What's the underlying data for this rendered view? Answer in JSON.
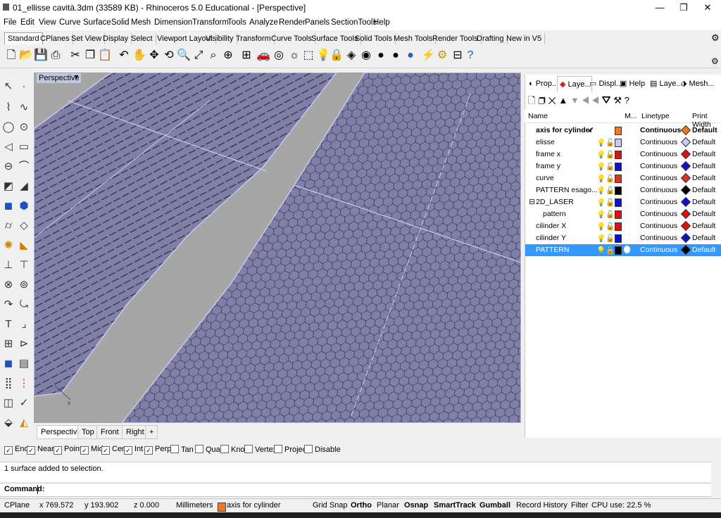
{
  "window": {
    "title": "01_ellisse cavità.3dm (33589 KB) - Rhinoceros 5.0 Educational - [Perspective]",
    "minimize_icon": "minimize-icon",
    "maximize_icon": "restore-icon",
    "close_icon": "close-icon"
  },
  "menu": [
    "File",
    "Edit",
    "View",
    "Curve",
    "Surface",
    "Solid",
    "Mesh",
    "Dimension",
    "Transform",
    "Tools",
    "Analyze",
    "Render",
    "Panels",
    "SectionTools",
    "Help"
  ],
  "toolbar_tabs": [
    "Standard",
    "CPlanes",
    "Set View",
    "Display",
    "Select",
    "Viewport Layout",
    "Visibility",
    "Transform",
    "Curve Tools",
    "Surface Tools",
    "Solid Tools",
    "Mesh Tools",
    "Render Tools",
    "Drafting",
    "New in V5"
  ],
  "toolbar_icons": [
    "new-icon",
    "open-icon",
    "save-icon",
    "print-icon",
    "cut-icon",
    "copy-icon",
    "paste-icon",
    "undo-icon",
    "pan-icon",
    "move-icon",
    "rotate-view-icon",
    "zoom-icon",
    "zoom-extents-icon",
    "zoom-window-icon",
    "zoom-selected-icon",
    "four-views-icon",
    "car-icon",
    "camera-icon",
    "light-icon",
    "select-icon",
    "bulb-icon",
    "lock-icon",
    "shading-icon",
    "color-wheel-icon",
    "sphere-icon",
    "sphere-dark-icon",
    "render-icon",
    "light-spot-icon",
    "options-icon",
    "layers-icon",
    "help-icon"
  ],
  "viewport": {
    "label": "Perspective",
    "tabs": [
      "Perspective",
      "Top",
      "Front",
      "Right"
    ],
    "colors": {
      "surface": "#7f7fa8",
      "road": "#a6a6a6",
      "edge": "#c8c8f0"
    }
  },
  "panel": {
    "tabs": [
      "Prop...",
      "Laye...",
      "Displ...",
      "Help",
      "Laye...",
      "Mesh..."
    ],
    "columns": {
      "name": "Name",
      "material": "M...",
      "linetype": "Linetype",
      "print_width": "Print Width"
    },
    "layers": [
      {
        "name": "axis for cylinder",
        "current": "✓",
        "color": "#f07820",
        "linetype": "Continuous",
        "print_width": "Default",
        "bold": true
      },
      {
        "name": "elisse",
        "color": "#c8c8ff",
        "linetype": "Continuous",
        "print_width": "Default"
      },
      {
        "name": "frame x",
        "color": "#e01010",
        "linetype": "Continuous",
        "print_width": "Default"
      },
      {
        "name": "frame y",
        "color": "#1010d0",
        "linetype": "Continuous",
        "print_width": "Default"
      },
      {
        "name": "curve",
        "color": "#e03030",
        "linetype": "Continuous",
        "print_width": "Default"
      },
      {
        "name": "PATTERN esago...",
        "color": "#000000",
        "linetype": "Continuous",
        "print_width": "Default"
      },
      {
        "name": "2D_LASER",
        "color": "#1010d0",
        "linetype": "Continuous",
        "print_width": "Default",
        "expand": "⊟"
      },
      {
        "name": "pattern",
        "color": "#e01010",
        "linetype": "Continuous",
        "print_width": "Default",
        "indent": true
      },
      {
        "name": "cilinder X",
        "color": "#e01010",
        "linetype": "Continuous",
        "print_width": "Default"
      },
      {
        "name": "cilinder Y",
        "color": "#1010d0",
        "linetype": "Continuous",
        "print_width": "Default"
      },
      {
        "name": "PATTERN",
        "color": "#000000",
        "linetype": "Continuous",
        "print_width": "Default",
        "selected": true
      }
    ]
  },
  "osnaps": [
    {
      "label": "End",
      "checked": true
    },
    {
      "label": "Near",
      "checked": true
    },
    {
      "label": "Point",
      "checked": true
    },
    {
      "label": "Mid",
      "checked": true
    },
    {
      "label": "Cen",
      "checked": true
    },
    {
      "label": "Int",
      "checked": true
    },
    {
      "label": "Perp",
      "checked": true
    },
    {
      "label": "Tan",
      "checked": false
    },
    {
      "label": "Quad",
      "checked": false
    },
    {
      "label": "Knot",
      "checked": false
    },
    {
      "label": "Vertex",
      "checked": false
    },
    {
      "label": "Project",
      "checked": false
    },
    {
      "label": "Disable",
      "checked": false
    }
  ],
  "command": {
    "history": "1 surface added to selection.",
    "prompt": "Command:"
  },
  "status": {
    "cplane": "CPlane",
    "x": "x 769.572",
    "y": "y 193.902",
    "z": "z 0.000",
    "units": "Millimeters",
    "layer": "axis for cylinder",
    "layer_color": "#f07820",
    "grid_snap": "Grid Snap",
    "ortho": "Ortho",
    "planar": "Planar",
    "osnap": "Osnap",
    "smarttrack": "SmartTrack",
    "gumball": "Gumball",
    "record_history": "Record History",
    "filter": "Filter",
    "cpu": "CPU use: 22.5 %"
  }
}
